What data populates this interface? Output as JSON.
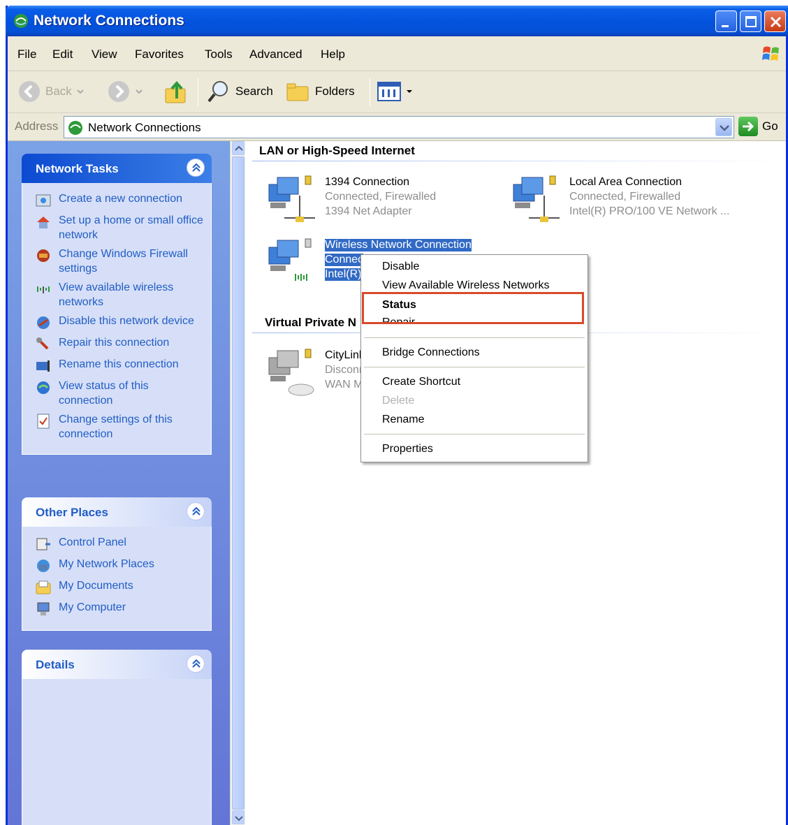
{
  "window": {
    "title": "Network Connections"
  },
  "menu": [
    "File",
    "Edit",
    "View",
    "Favorites",
    "Tools",
    "Advanced",
    "Help"
  ],
  "toolbar": {
    "back": "Back",
    "search": "Search",
    "folders": "Folders"
  },
  "address": {
    "label": "Address",
    "value": "Network Connections",
    "go": "Go"
  },
  "network_tasks": {
    "title": "Network Tasks",
    "items": [
      "Create a new connection",
      "Set up a home or small office network",
      "Change Windows Firewall settings",
      "View available wireless networks",
      "Disable this network device",
      "Repair this connection",
      "Rename this connection",
      "View status of this connection",
      "Change settings of this connection"
    ]
  },
  "other_places": {
    "title": "Other Places",
    "items": [
      "Control Panel",
      "My Network Places",
      "My Documents",
      "My Computer"
    ]
  },
  "details": {
    "title": "Details"
  },
  "groups": {
    "lan": "LAN or High-Speed Internet",
    "vpn": "Virtual Private N"
  },
  "connections": {
    "c1394": {
      "name": "1394 Connection",
      "status": "Connected, Firewalled",
      "device": "1394 Net Adapter"
    },
    "local": {
      "name": "Local Area Connection",
      "status": "Connected, Firewalled",
      "device": "Intel(R) PRO/100 VE Network ..."
    },
    "wireless": {
      "name": "Wireless Network Connection",
      "status": "Connec",
      "device": "Intel(R)"
    },
    "citylink": {
      "name": "CityLink",
      "status": "Disconn",
      "device": "WAN Mi"
    }
  },
  "context_menu": {
    "disable": "Disable",
    "view_wireless": "View Available Wireless Networks",
    "status": "Status",
    "repair": "Repair",
    "bridge": "Bridge Connections",
    "shortcut": "Create Shortcut",
    "delete": "Delete",
    "rename": "Rename",
    "properties": "Properties"
  },
  "colors": {
    "titlebar": "#0453de",
    "selection": "#316ac5",
    "highlight_box": "#d94a2a",
    "link": "#215dc6"
  }
}
